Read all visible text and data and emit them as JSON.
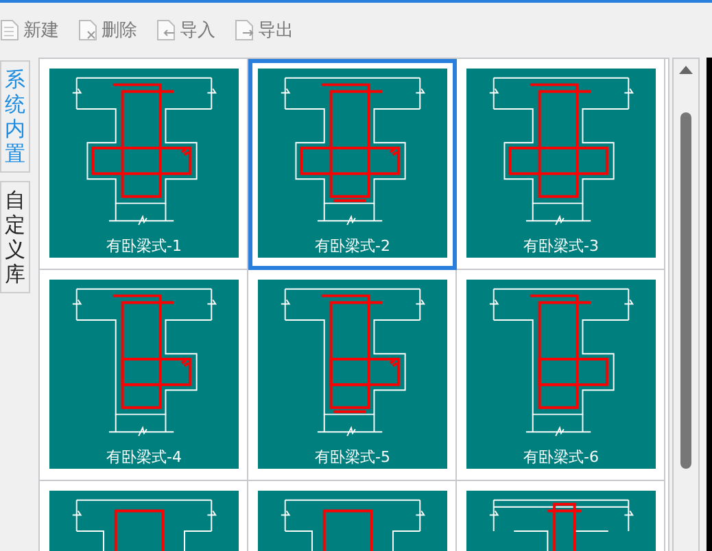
{
  "toolbar": [
    {
      "label": "新建",
      "kind": "new"
    },
    {
      "label": "删除",
      "kind": "delete"
    },
    {
      "label": "导入",
      "kind": "import"
    },
    {
      "label": "导出",
      "kind": "export"
    }
  ],
  "side_tabs": [
    {
      "label": "系统内置",
      "selected": true
    },
    {
      "label": "自定义库",
      "selected": false
    }
  ],
  "styles": [
    {
      "label": "有卧梁式-1",
      "kind": "cross",
      "selected": false
    },
    {
      "label": "有卧梁式-2",
      "kind": "cross",
      "selected": true
    },
    {
      "label": "有卧梁式-3",
      "kind": "cross",
      "selected": false
    },
    {
      "label": "有卧梁式-4",
      "kind": "side",
      "selected": false
    },
    {
      "label": "有卧梁式-5",
      "kind": "side",
      "selected": false
    },
    {
      "label": "有卧梁式-6",
      "kind": "side",
      "selected": false
    },
    {
      "kind": "wide",
      "selected": false
    },
    {
      "kind": "wide",
      "selected": false
    },
    {
      "kind": "narrow",
      "selected": false
    }
  ]
}
